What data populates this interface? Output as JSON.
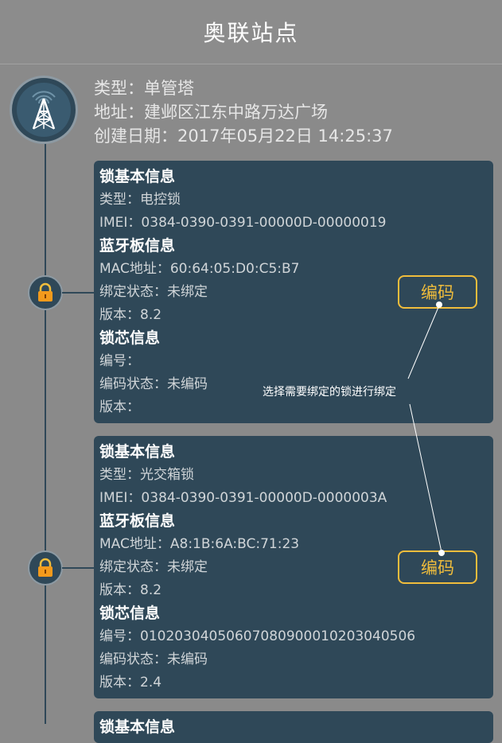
{
  "header": {
    "title": "奥联站点"
  },
  "site": {
    "type_label": "类型：",
    "type_value": "单管塔",
    "address_label": "地址：",
    "address_value": "建邺区江东中路万达广场",
    "created_label": "创建日期：",
    "created_value": "2017年05月22日 14:25:37"
  },
  "locks": [
    {
      "basic_title": "锁基本信息",
      "type_row": "类型：电控锁",
      "imei_row": "IMEI：0384-0390-0391-00000D-00000019",
      "bt_title": "蓝牙板信息",
      "mac_row": "MAC地址：60:64:05:D0:C5:B7",
      "bind_row": "绑定状态：未绑定",
      "version_row": "版本：8.2",
      "core_title": "锁芯信息",
      "code_row": "编号：",
      "code_state_row": "编码状态：未编码",
      "core_version_row": "版本：",
      "button_label": "编码"
    },
    {
      "basic_title": "锁基本信息",
      "type_row": "类型：光交箱锁",
      "imei_row": "IMEI：0384-0390-0391-00000D-0000003A",
      "bt_title": "蓝牙板信息",
      "mac_row": "MAC地址：A8:1B:6A:BC:71:23",
      "bind_row": "绑定状态：未绑定",
      "version_row": "版本：8.2",
      "core_title": "锁芯信息",
      "code_row": "编号：01020304050607080900010203040506",
      "code_state_row": "编码状态：未编码",
      "core_version_row": "版本：2.4",
      "button_label": "编码"
    },
    {
      "basic_title": "锁基本信息"
    }
  ],
  "annotation": {
    "text": "选择需要绑定的锁进行绑定"
  },
  "colors": {
    "card_bg": "#2f4858",
    "accent": "#f0bd3c",
    "page_bg": "#8a8a8a"
  },
  "icons": {
    "site": "radio-tower-icon",
    "lock": "padlock-icon"
  }
}
